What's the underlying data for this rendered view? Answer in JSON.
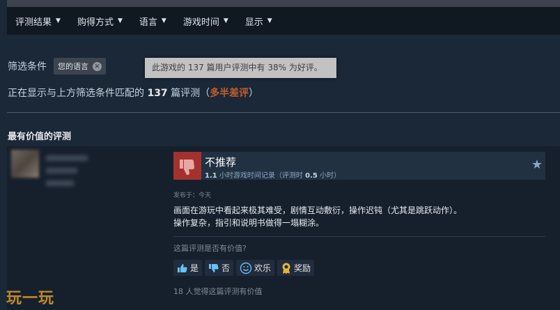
{
  "filter_menu": {
    "items": [
      {
        "label": "评测结果"
      },
      {
        "label": "购得方式"
      },
      {
        "label": "语言"
      },
      {
        "label": "游戏时间"
      },
      {
        "label": "显示"
      }
    ]
  },
  "filters": {
    "label": "筛选条件",
    "chip_label": "您的语言",
    "tooltip": "此游戏的 137 篇用户评测中有 38% 为好评。"
  },
  "summary": {
    "prefix": "正在显示与上方筛选条件匹配的",
    "count": "137",
    "suffix": "篇评测（",
    "rating": "多半差评",
    "close": "）",
    "rating_color": "#c35c2c"
  },
  "section_title": "最有价值的评测",
  "review": {
    "verdict": "不推荐",
    "verdict_icon": "thumbs-down-icon",
    "hours_value": "1.1",
    "hours_text": "小时游戏时间记录（评测时",
    "hours_at_review": "0.5",
    "hours_suffix": "小时）",
    "posted": "发布于：今天",
    "content_line1": "画面在游玩中看起来极其难受，剧情互动敷衍，操作迟钝（尤其是跳跃动作）。",
    "content_line2": "操作复杂，指引和说明书做得一塌糊涂。",
    "helpful_question": "这篇评测是否有价值?",
    "buttons": {
      "yes": "是",
      "no": "否",
      "funny": "欢乐",
      "award": "奖励"
    },
    "helpful_count": "18 人觉得这篇评测有价值"
  },
  "watermark": "玩一玩",
  "colors": {
    "background": "#1b2838",
    "negative_thumb": "#a3322f",
    "accent_orange": "#c35c2c"
  }
}
